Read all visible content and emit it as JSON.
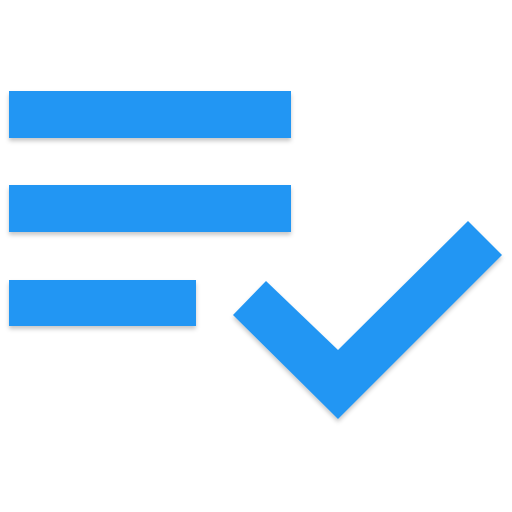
{
  "icon": {
    "name": "playlist-add-check-icon",
    "color": "#2196F3",
    "background": "#FFFFFF",
    "lines": 3
  }
}
